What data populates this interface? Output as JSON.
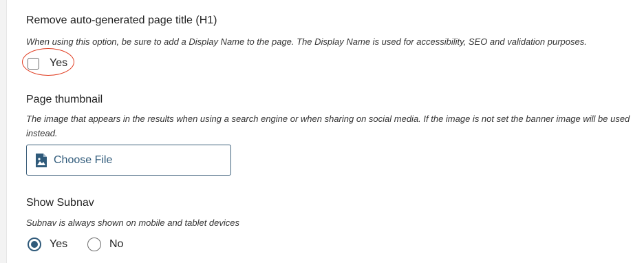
{
  "remove_title": {
    "label": "Remove auto-generated page title (H1)",
    "help": "When using this option, be sure to add a Display Name to the page. The Display Name is used for accessibility, SEO and validation purposes.",
    "checkbox_label": "Yes",
    "checked": false,
    "highlight_color": "#e03a1e"
  },
  "thumbnail": {
    "label": "Page thumbnail",
    "help_line1": "The image that appears in the results when using a search engine or when sharing on social media. If the image is not set the banner image will be used",
    "help_line2": "instead.",
    "button_label": "Choose File",
    "button_icon": "image-file-icon",
    "accent_color": "#2f5a7a"
  },
  "subnav": {
    "label": "Show Subnav",
    "help": "Subnav is always shown on mobile and tablet devices",
    "options": [
      {
        "label": "Yes",
        "selected": true
      },
      {
        "label": "No",
        "selected": false
      }
    ]
  }
}
